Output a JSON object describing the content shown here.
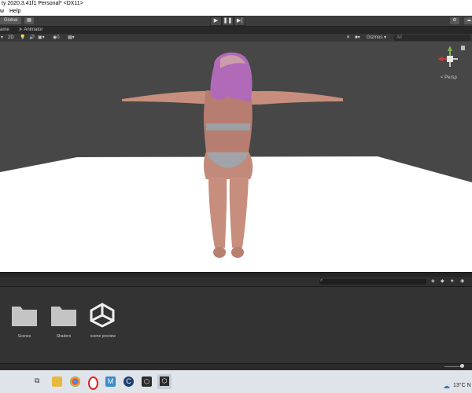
{
  "window": {
    "title": "ty 2020.3.41f1 Personal* <DX11>"
  },
  "menu": {
    "items": [
      "w",
      "Help"
    ]
  },
  "toolbar": {
    "layer_label": "Global",
    "play_icon": "play-icon",
    "pause_icon": "pause-icon",
    "step_icon": "step-icon"
  },
  "tabs": {
    "scene_label": "ame",
    "animator_label": "Animator"
  },
  "scene_toolbar": {
    "mode_2d": "2D",
    "gizmos_label": "Gizmos",
    "search_placeholder": "All"
  },
  "scene": {
    "background_color": "#474747",
    "floor_color": "#ffffff",
    "projection_label": "< Persp",
    "model_description": "character-model-t-pose"
  },
  "project": {
    "assets": [
      {
        "name": "Scenes",
        "icon": "folder-icon"
      },
      {
        "name": "Shaders",
        "icon": "folder-icon"
      },
      {
        "name": "scene preview",
        "icon": "unity-logo-icon"
      }
    ]
  },
  "taskbar": {
    "weather": "13°C  N",
    "apps": [
      "file-explorer-icon",
      "chrome-icon",
      "opera-icon",
      "m-app-icon",
      "c-app-icon",
      "unity-hub-icon",
      "unity-icon"
    ]
  },
  "colors": {
    "accent": "#3a79bb",
    "dark_panel": "#333333",
    "toolbar": "#3c3c3c"
  }
}
